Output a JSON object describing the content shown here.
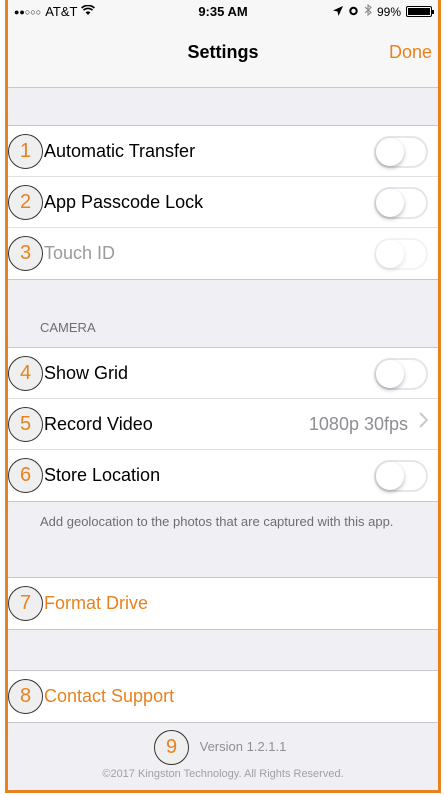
{
  "status_bar": {
    "carrier": "AT&T",
    "signal_dots": "●●○○○",
    "time": "9:35 AM",
    "battery": "99%"
  },
  "navbar": {
    "title": "Settings",
    "done_label": "Done"
  },
  "group1": [
    {
      "badge": "1",
      "label": "Automatic Transfer",
      "toggle": false,
      "enabled": true
    },
    {
      "badge": "2",
      "label": "App Passcode Lock",
      "toggle": false,
      "enabled": true
    },
    {
      "badge": "3",
      "label": "Touch ID",
      "toggle": false,
      "enabled": false
    }
  ],
  "camera_section": {
    "header": "CAMERA",
    "rows": [
      {
        "badge": "4",
        "label": "Show Grid",
        "toggle": false
      },
      {
        "badge": "5",
        "label": "Record Video",
        "value": "1080p 30fps"
      },
      {
        "badge": "6",
        "label": "Store Location",
        "toggle": false
      }
    ],
    "footer": "Add geolocation to the photos that are captured with this app."
  },
  "format_drive": {
    "badge": "7",
    "label": "Format Drive"
  },
  "contact_support": {
    "badge": "8",
    "label": "Contact Support"
  },
  "version": {
    "badge": "9",
    "text": "Version 1.2.1.1"
  },
  "copyright": "©2017 Kingston Technology. All Rights Reserved.",
  "colors": {
    "accent": "#e8821e",
    "background": "#efeff4",
    "separator": "#c8c7cc"
  },
  "icons": [
    "location-arrow-icon",
    "alarm-icon",
    "bluetooth-icon",
    "wifi-icon",
    "battery-icon",
    "chevron-right-icon"
  ]
}
